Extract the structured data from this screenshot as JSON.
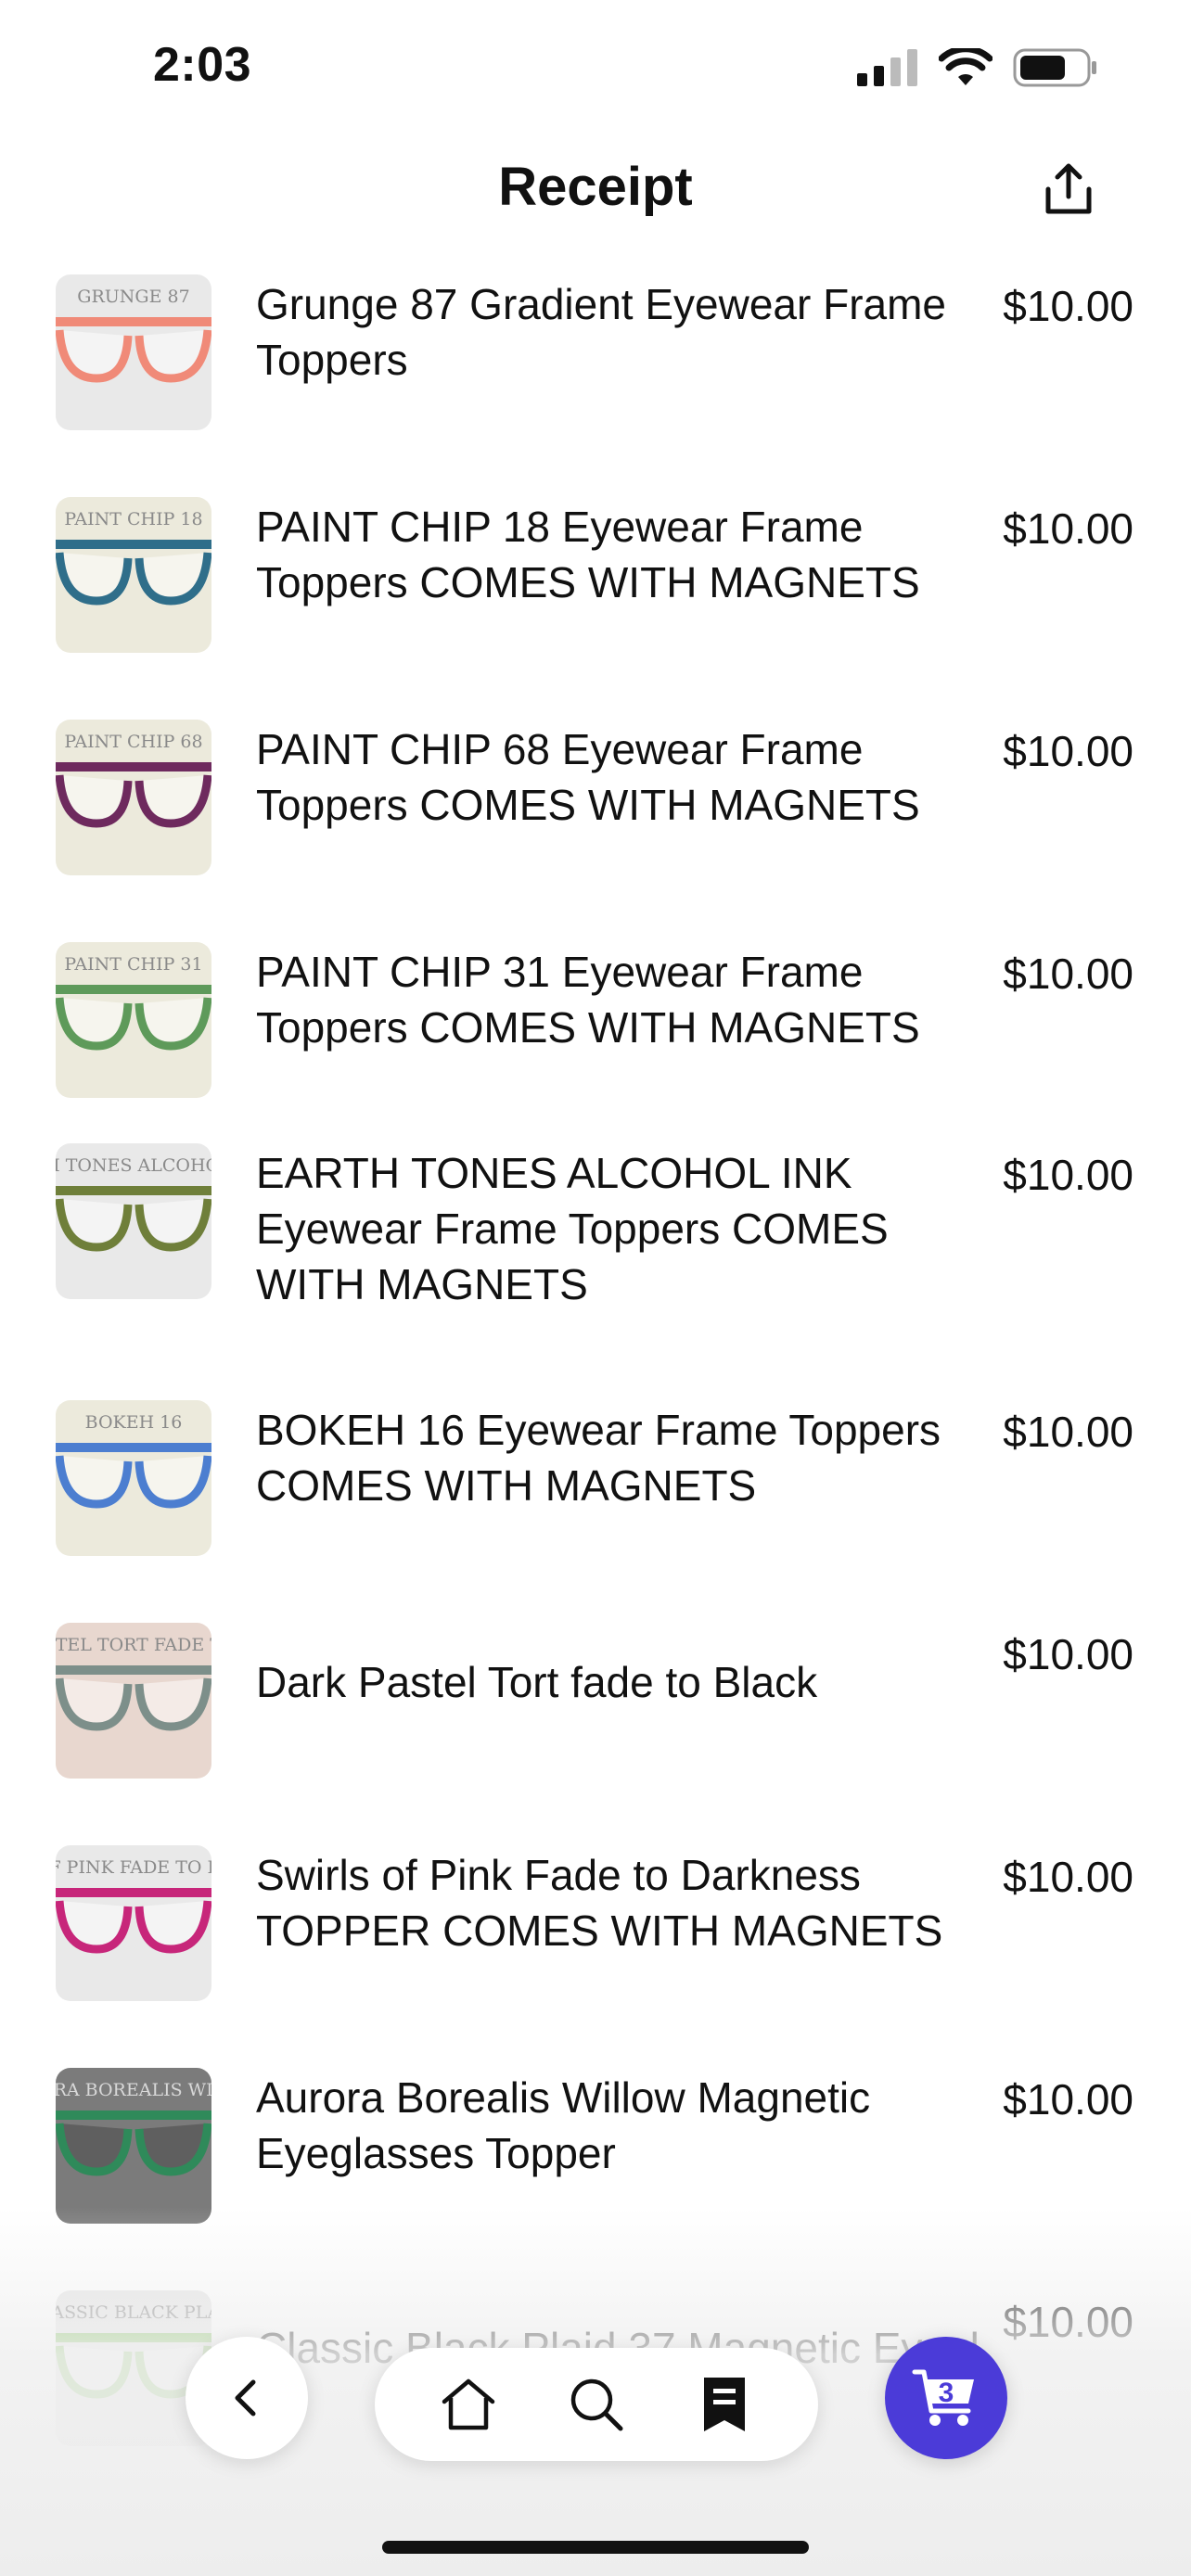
{
  "status_bar": {
    "time": "2:03"
  },
  "header": {
    "title": "Receipt"
  },
  "items": [
    {
      "title": "Grunge 87 Gradient Eyewear Frame Toppers",
      "price": "$10.00",
      "thumb_caption": "GRUNGE 87",
      "thumb_bg": "#e9e9e9",
      "frame_color": "#f08a78"
    },
    {
      "title": "PAINT CHIP 18 Eyewear Frame Toppers COMES WITH MAGNETS",
      "price": "$10.00",
      "thumb_caption": "PAINT CHIP 18",
      "thumb_bg": "#eceadc",
      "frame_color": "#2f6e8a"
    },
    {
      "title": "PAINT CHIP 68 Eyewear Frame Toppers COMES WITH MAGNETS",
      "price": "$10.00",
      "thumb_caption": "PAINT CHIP 68",
      "thumb_bg": "#eceadc",
      "frame_color": "#6e2a5e"
    },
    {
      "title": "PAINT CHIP 31 Eyewear Frame Toppers COMES WITH MAGNETS",
      "price": "$10.00",
      "thumb_caption": "PAINT CHIP 31",
      "thumb_bg": "#eceadc",
      "frame_color": "#5e9a5a"
    },
    {
      "title": "EARTH TONES ALCOHOL INK Eyewear Frame Toppers COMES WITH MAGNETS",
      "price": "$10.00",
      "thumb_caption": "EARTH TONES ALCOHOL INK",
      "thumb_bg": "#e9e9e9",
      "frame_color": "#6f7f3a"
    },
    {
      "title": "BOKEH 16 Eyewear Frame Toppers COMES WITH MAGNETS",
      "price": "$10.00",
      "thumb_caption": "BOKEH 16",
      "thumb_bg": "#eceadc",
      "frame_color": "#4c7ed0"
    },
    {
      "title": "Dark Pastel Tort fade to Black",
      "price": "$10.00",
      "thumb_caption": "DARK PASTEL TORT FADE TO BLACK",
      "thumb_bg": "#e8d7cf",
      "frame_color": "#7d8f8a"
    },
    {
      "title": "Swirls of Pink Fade to Darkness TOPPER COMES WITH MAGNETS",
      "price": "$10.00",
      "thumb_caption": "SWIRLS OF PINK FADE TO DARKNESS",
      "thumb_bg": "#e9e9e9",
      "frame_color": "#c7267a"
    },
    {
      "title": "Aurora Borealis Willow Magnetic Eyeglasses Topper",
      "price": "$10.00",
      "thumb_caption": "AURORA BOREALIS WILLOW",
      "thumb_bg": "#7b7b7b",
      "frame_color": "#2f8a5a"
    },
    {
      "title": "Classic Black Plaid 37 Magnetic Eyegl",
      "price": "$10.00",
      "thumb_caption": "CLASSIC BLACK PLAID",
      "thumb_bg": "#e6e6e6",
      "frame_color": "#7fbf5a"
    }
  ],
  "cart": {
    "count": "3"
  },
  "icons": {
    "share": "share-icon",
    "back": "chevron-left-icon",
    "home": "home-icon",
    "search": "search-icon",
    "receipt": "receipt-icon",
    "cart": "cart-icon"
  },
  "colors": {
    "accent": "#4b3bd8"
  }
}
